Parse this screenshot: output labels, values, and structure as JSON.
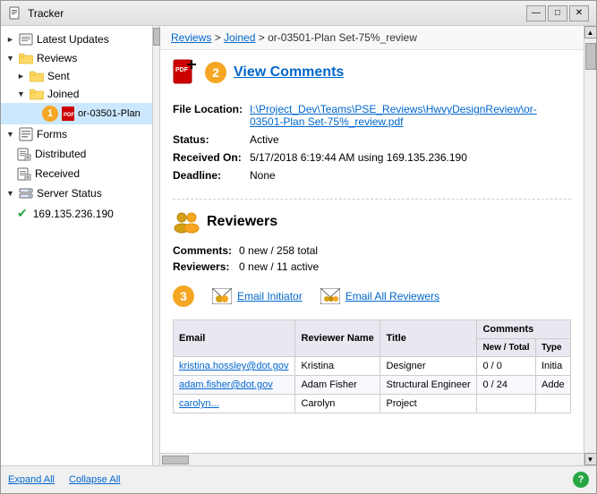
{
  "window": {
    "title": "Tracker",
    "controls": [
      "minimize",
      "restore",
      "close"
    ]
  },
  "sidebar": {
    "items": [
      {
        "id": "latest-updates",
        "label": "Latest Updates",
        "indent": 0,
        "expanded": false,
        "icon": "clock"
      },
      {
        "id": "reviews",
        "label": "Reviews",
        "indent": 0,
        "expanded": true,
        "icon": "folder"
      },
      {
        "id": "sent",
        "label": "Sent",
        "indent": 1,
        "expanded": false,
        "icon": "folder"
      },
      {
        "id": "joined",
        "label": "Joined",
        "indent": 1,
        "expanded": true,
        "icon": "folder",
        "badge": "1"
      },
      {
        "id": "or-03501-plan",
        "label": "or-03501-Plan",
        "indent": 2,
        "expanded": false,
        "icon": "pdf",
        "selected": true
      },
      {
        "id": "forms",
        "label": "Forms",
        "indent": 0,
        "expanded": true,
        "icon": "forms"
      },
      {
        "id": "distributed",
        "label": "Distributed",
        "indent": 1,
        "expanded": false,
        "icon": "form-item",
        "badge": ""
      },
      {
        "id": "received",
        "label": "Received",
        "indent": 1,
        "expanded": false,
        "icon": "form-item"
      },
      {
        "id": "server-status",
        "label": "Server Status",
        "indent": 0,
        "expanded": true,
        "icon": "server"
      },
      {
        "id": "server-ip",
        "label": "169.135.236.190",
        "indent": 1,
        "expanded": false,
        "icon": "check"
      }
    ],
    "bottom": {
      "expand_all": "Expand All",
      "collapse_all": "Collapse All",
      "help": "?"
    }
  },
  "breadcrumb": {
    "parts": [
      "Reviews",
      "Joined",
      "or-03501-Plan Set-75%_review"
    ],
    "links": [
      true,
      true,
      false
    ]
  },
  "main": {
    "step1_badge": "1",
    "step2_badge": "2",
    "step3_badge": "3",
    "view_comments_label": "View Comments",
    "file_location_label": "File Location:",
    "file_location_value": "I:\\Project_Dev\\Teams\\PSE_Reviews\\HwvyDesignReview\\or-03501-Plan Set-75%_review.pdf",
    "status_label": "Status:",
    "status_value": "Active",
    "received_on_label": "Received On:",
    "received_on_value": "5/17/2018 6:19:44 AM using 169.135.236.190",
    "deadline_label": "Deadline:",
    "deadline_value": "None",
    "reviewers_title": "Reviewers",
    "comments_label": "Comments:",
    "comments_value": "0 new / 258 total",
    "reviewers_label": "Reviewers:",
    "reviewers_value": "0 new / 11 active",
    "email_initiator": "Email Initiator",
    "email_all_reviewers": "Email All Reviewers",
    "table": {
      "headers": {
        "email": "Email",
        "reviewer_name": "Reviewer Name",
        "title": "Title",
        "comments_group": "Comments",
        "new_total": "New / Total",
        "type": "Type"
      },
      "rows": [
        {
          "email": "kristina.hossley@dot.gov",
          "reviewer_name": "Kristina",
          "title": "Designer",
          "new_total": "0 / 0",
          "type": "Initia"
        },
        {
          "email": "adam.fisher@dot.gov",
          "reviewer_name": "Adam Fisher",
          "title": "Structural Engineer",
          "new_total": "0 / 24",
          "type": "Adde"
        },
        {
          "email": "carolyn...",
          "reviewer_name": "Carolyn",
          "title": "Project",
          "new_total": "",
          "type": ""
        }
      ]
    }
  },
  "colors": {
    "accent_orange": "#f5a623",
    "link_blue": "#0066cc",
    "header_bg": "#e8e8f0",
    "green_check": "#28a745"
  }
}
